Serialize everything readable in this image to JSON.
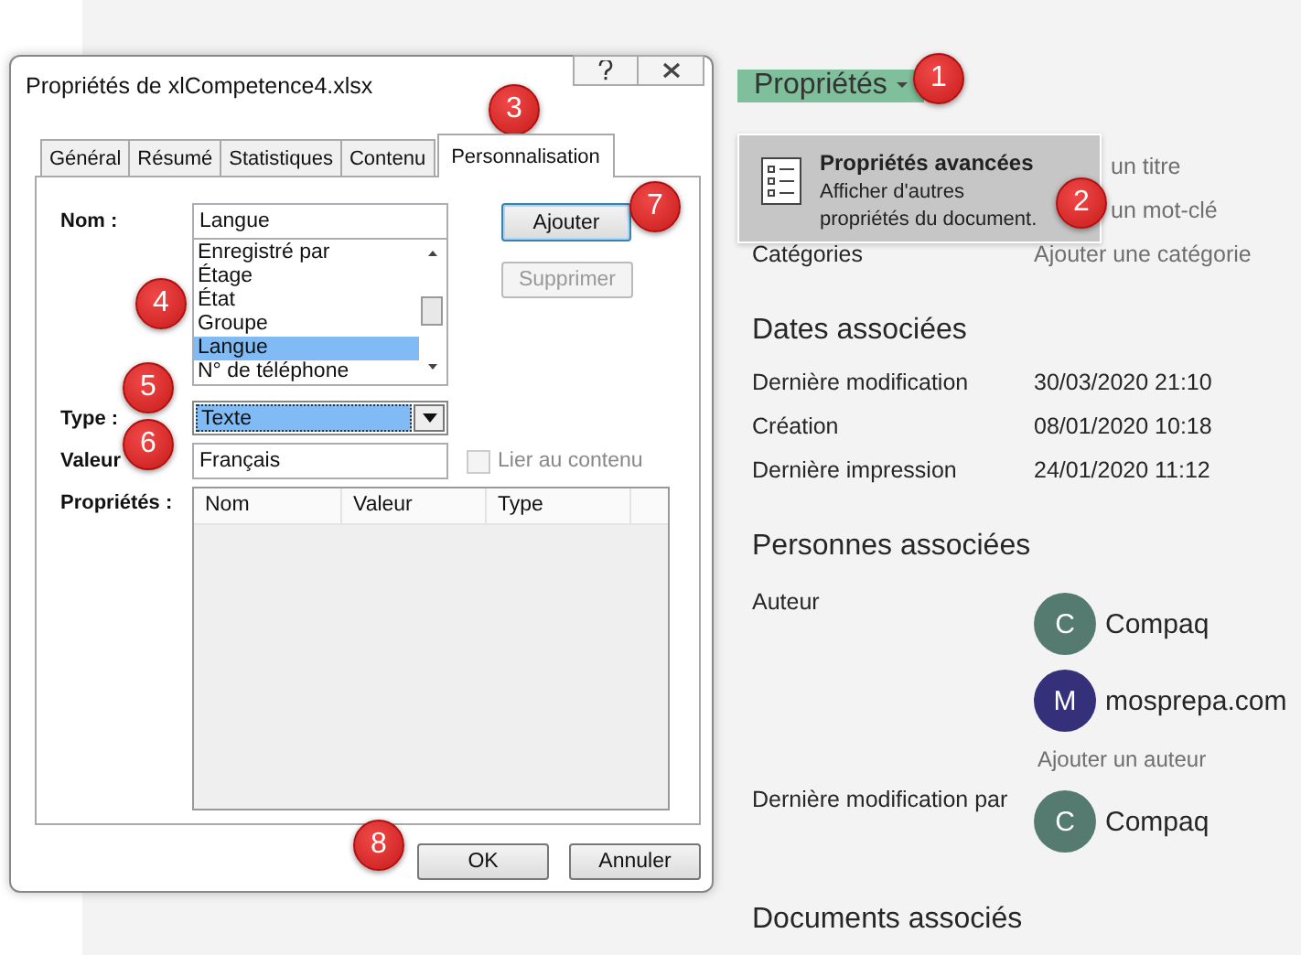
{
  "backstage": {
    "properties_button": "Propriétés",
    "menu": {
      "title": "Propriétés avancées",
      "description": "Afficher d'autres propriétés du document."
    },
    "property_rows": [
      {
        "value": "un titre",
        "kind": "cut"
      },
      {
        "value": "un mot-clé",
        "kind": "cut"
      },
      {
        "label": "Catégories",
        "value": "Ajouter une catégorie",
        "kind": "placeholder"
      }
    ],
    "dates_heading": "Dates associées",
    "date_rows": [
      {
        "label": "Dernière modification",
        "value": "30/03/2020 21:10"
      },
      {
        "label": "Création",
        "value": "08/01/2020 10:18"
      },
      {
        "label": "Dernière impression",
        "value": "24/01/2020 11:12"
      }
    ],
    "people_heading": "Personnes associées",
    "author_label": "Auteur",
    "authors": [
      {
        "initial": "C",
        "name": "Compaq",
        "color": "#557a6f"
      },
      {
        "initial": "M",
        "name": "mosprepa.com",
        "color": "#35307a"
      }
    ],
    "add_author": "Ajouter un auteur",
    "modified_by_label": "Dernière modification par",
    "modified_by": [
      {
        "initial": "C",
        "name": "Compaq",
        "color": "#557a6f"
      }
    ],
    "documents_heading": "Documents associés"
  },
  "dialog": {
    "title": "Propriétés de xlCompetence4.xlsx",
    "tabs": [
      {
        "label": "Général",
        "selected": false
      },
      {
        "label": "Résumé",
        "selected": false
      },
      {
        "label": "Statistiques",
        "selected": false
      },
      {
        "label": "Contenu",
        "selected": false
      },
      {
        "label": "Personnalisation",
        "selected": true
      }
    ],
    "name_label": "Nom :",
    "name_value": "Langue",
    "name_list": [
      {
        "label": "Enregistré par",
        "selected": false
      },
      {
        "label": "Étage",
        "selected": false
      },
      {
        "label": "État",
        "selected": false
      },
      {
        "label": "Groupe",
        "selected": false
      },
      {
        "label": "Langue",
        "selected": true
      },
      {
        "label": "N° de téléphone",
        "selected": false
      }
    ],
    "add_button": {
      "label": "Ajouter",
      "disabled": false
    },
    "remove_button": {
      "label": "Supprimer",
      "disabled": true
    },
    "type_label": "Type :",
    "type_value": "Texte",
    "value_label": "Valeur",
    "value_value": "Français",
    "link_checkbox": {
      "label": "Lier au contenu",
      "checked": false,
      "disabled": true
    },
    "properties_label": "Propriétés :",
    "properties_columns": [
      "Nom",
      "Valeur",
      "Type"
    ],
    "footer_buttons": [
      "OK",
      "Annuler"
    ]
  },
  "callouts": [
    "1",
    "2",
    "3",
    "4",
    "5",
    "6",
    "7",
    "8"
  ]
}
